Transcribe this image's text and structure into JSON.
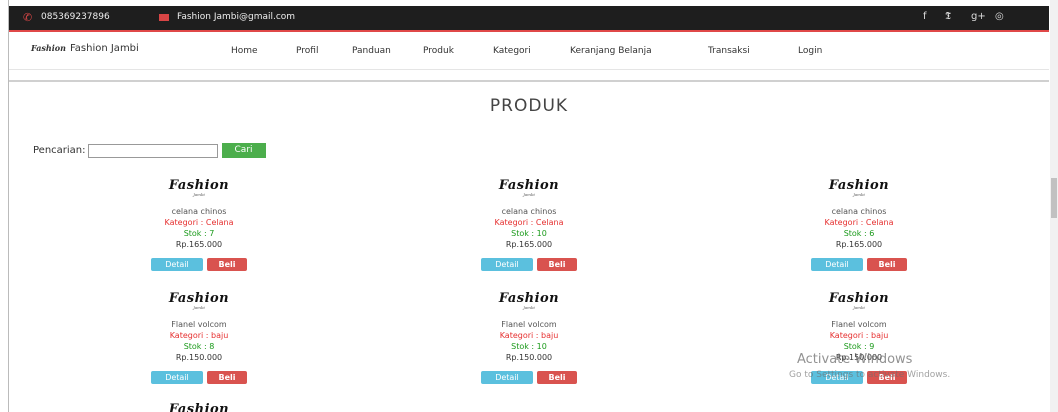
{
  "topbar": {
    "phone": "085369237896",
    "email": "Fashion Jambi@gmail.com",
    "social": [
      "f",
      "𝕿",
      "g+",
      "◎"
    ]
  },
  "navbar": {
    "brand_mark": "Fashion",
    "brand_name": "Fashion Jambi",
    "items": [
      "Home",
      "Profil",
      "Panduan",
      "Produk",
      "Kategori",
      "Keranjang Belanja",
      "Transaksi",
      "Login"
    ]
  },
  "page": {
    "title": "PRODUK"
  },
  "search": {
    "label": "Pencarian:",
    "value": "",
    "button": "Cari"
  },
  "products": [
    {
      "name": "celana chinos",
      "category": "Kategori : Celana",
      "stock": "Stok : 7",
      "price": "Rp.165.000"
    },
    {
      "name": "celana chinos",
      "category": "Kategori : Celana",
      "stock": "Stok : 10",
      "price": "Rp.165.000"
    },
    {
      "name": "celana chinos",
      "category": "Kategori : Celana",
      "stock": "Stok : 6",
      "price": "Rp.165.000"
    },
    {
      "name": "Flanel volcom",
      "category": "Kategori : baju",
      "stock": "Stok : 8",
      "price": "Rp.150.000"
    },
    {
      "name": "Flanel volcom",
      "category": "Kategori : baju",
      "stock": "Stok : 10",
      "price": "Rp.150.000"
    },
    {
      "name": "Flanel volcom",
      "category": "Kategori : baju",
      "stock": "Stok : 9",
      "price": "Rp.150.000"
    }
  ],
  "product_logo": {
    "main": "Fashion",
    "sub": "Jambi"
  },
  "buttons": {
    "detail": "Detail",
    "beli": "Beli"
  },
  "watermark": {
    "line1": "Activate Windows",
    "line2": "Go to Settings to activate Windows."
  }
}
